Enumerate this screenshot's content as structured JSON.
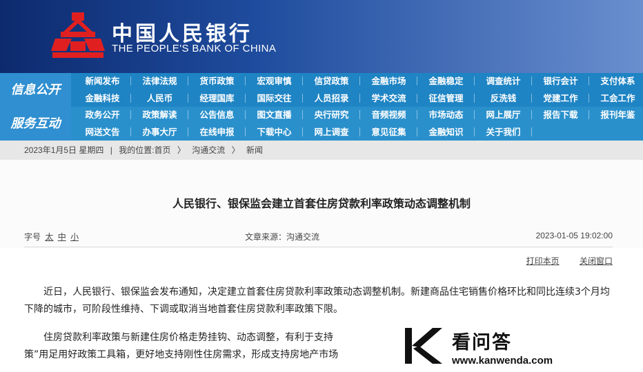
{
  "header": {
    "bank_name_cn": "中国人民银行",
    "bank_name_en": "THE PEOPLE'S BANK OF CHINA",
    "logo_color": "#e02020"
  },
  "nav": {
    "section1_title": "信息公开",
    "section2_title": "服务互动",
    "section1_items": [
      "新闻发布",
      "法律法规",
      "货币政策",
      "宏观审慎",
      "信贷政策",
      "金融市场",
      "金融稳定",
      "调查统计",
      "银行会计",
      "支付体系",
      "金融科技",
      "人民币",
      "经理国库",
      "国际交往",
      "人员招录",
      "学术交流",
      "征信管理",
      "反洗钱",
      "党建工作",
      "工会工作"
    ],
    "section2_items": [
      "政务公开",
      "政策解读",
      "公告信息",
      "图文直播",
      "央行研究",
      "音频视频",
      "市场动态",
      "网上展厅",
      "报告下载",
      "报刊年鉴",
      "网送文告",
      "办事大厅",
      "在线申报",
      "下载中心",
      "网上调查",
      "意见征集",
      "金融知识",
      "关于我们"
    ]
  },
  "breadcrumb": {
    "date": "2023年1月5日 星期四",
    "sep": "|",
    "location_label": "我的位置:首页",
    "crumb1": "沟通交流",
    "crumb2": "新闻",
    "arrow": "〉"
  },
  "article": {
    "title": "人民银行、银保监会建立首套住房贷款利率政策动态调整机制",
    "font_size_label": "字号",
    "font_large": "太",
    "font_medium": "中",
    "font_small": "小",
    "source": "文章来源：沟通交流",
    "datetime": "2023-01-05 19:02:00",
    "print_label": "打印本页",
    "close_label": "关闭窗口",
    "para1": "近日，人民银行、银保监会发布通知，决定建立首套住房贷款利率政策动态调整机制。新建商品住宅销售价格环比和同比连续3个月均下降的城市，可阶段性维持、下调或取消当地首套住房贷款利率政策下限。",
    "para2": "住房贷款利率政策与新建住房价格走势挂钩、动态调整，有利于支持",
    "para2b": "策”用足用好政策工具箱，更好地支持刚性住房需求，形成支持房地产市场"
  },
  "watermark": {
    "name": "看问答",
    "url": "www.kanwenda.com"
  }
}
